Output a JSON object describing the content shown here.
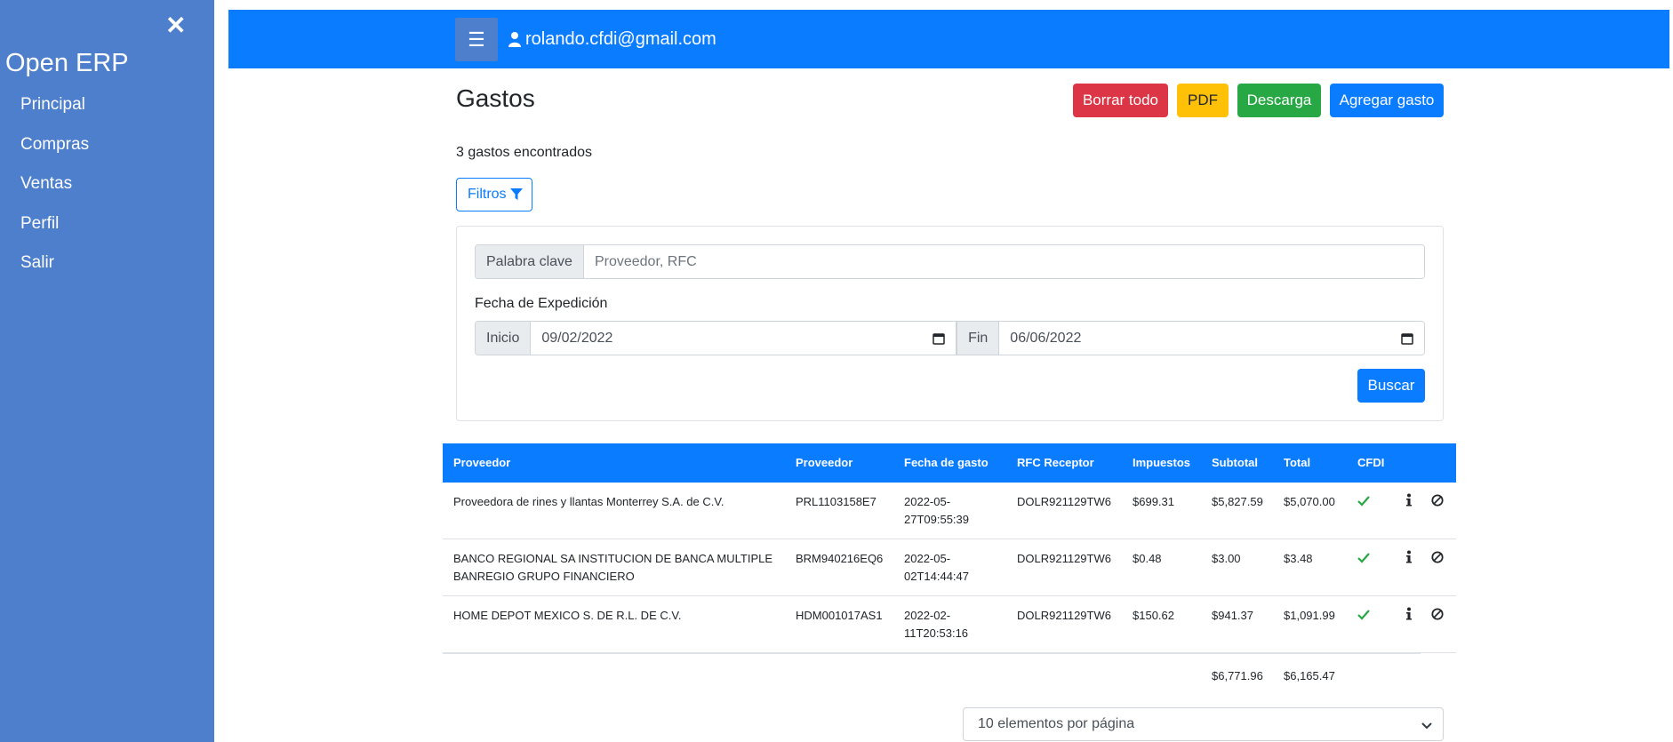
{
  "sidebar": {
    "brand": "Open ERP",
    "close_icon": "close-icon",
    "items": [
      {
        "label": "Principal"
      },
      {
        "label": "Compras"
      },
      {
        "label": "Ventas"
      },
      {
        "label": "Perfil"
      },
      {
        "label": "Salir"
      }
    ]
  },
  "topbar": {
    "menu_icon": "hamburger-icon",
    "menu_glyph": "☰",
    "user_email": "rolando.cfdi@gmail.com"
  },
  "header": {
    "title": "Gastos",
    "buttons": {
      "delete_all": "Borrar todo",
      "pdf": "PDF",
      "download": "Descarga",
      "add": "Agregar gasto"
    }
  },
  "count_text": "3 gastos encontrados",
  "filters": {
    "toggle_label": "Filtros",
    "keyword_label": "Palabra clave",
    "keyword_placeholder": "Proveedor, RFC",
    "keyword_value": "",
    "date_label": "Fecha de Expedición",
    "start_label": "Inicio",
    "start_value": "09/02/2022",
    "end_label": "Fin",
    "end_value": "06/06/2022",
    "search_label": "Buscar"
  },
  "table": {
    "headers": [
      "Proveedor",
      "Proveedor",
      "Fecha de gasto",
      "RFC Receptor",
      "Impuestos",
      "Subtotal",
      "Total",
      "CFDI"
    ],
    "rows": [
      {
        "proveedor": "Proveedora de rines y llantas Monterrey S.A. de C.V.",
        "rfc": "PRL1103158E7",
        "fecha_1": "2022-05-",
        "fecha_2": "27T09:55:39",
        "receptor": "DOLR921129TW6",
        "impuestos": "$699.31",
        "subtotal": "$5,827.59",
        "total": "$5,070.00"
      },
      {
        "proveedor_1": "BANCO REGIONAL SA INSTITUCION DE BANCA MULTIPLE",
        "proveedor_2": "BANREGIO GRUPO FINANCIERO",
        "rfc": "BRM940216EQ6",
        "fecha_1": "2022-05-",
        "fecha_2": "02T14:44:47",
        "receptor": "DOLR921129TW6",
        "impuestos": "$0.48",
        "subtotal": "$3.00",
        "total": "$3.48"
      },
      {
        "proveedor": "HOME DEPOT MEXICO S. DE R.L. DE C.V.",
        "rfc": "HDM001017AS1",
        "fecha_1": "2022-02-",
        "fecha_2": "11T20:53:16",
        "receptor": "DOLR921129TW6",
        "impuestos": "$150.62",
        "subtotal": "$941.37",
        "total": "$1,091.99"
      }
    ],
    "totals": {
      "subtotal": "$6,771.96",
      "total": "$6,165.47"
    }
  },
  "pagination": {
    "per_page_selected": "10 elementos por página"
  },
  "colors": {
    "sidebar": "#4d7fcc",
    "primary": "#0a7cff",
    "danger": "#dc3545",
    "warning": "#ffc107",
    "success": "#28a745"
  }
}
